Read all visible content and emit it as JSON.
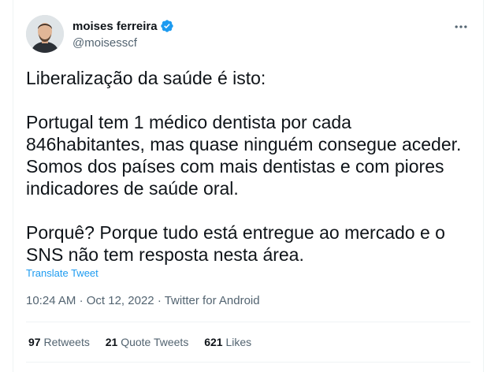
{
  "author": {
    "display_name": "moises ferreira",
    "handle": "@moisesscf",
    "verified": true
  },
  "icons": {
    "verified": "verified-badge-icon",
    "more": "more-options-icon"
  },
  "tweet": {
    "paragraphs": [
      "Liberalização da saúde é isto:",
      "Portugal tem 1 médico dentista por cada 846habitantes, mas quase ninguém consegue aceder. Somos dos países com mais dentistas e com piores indicadores de saúde oral.",
      "Porquê? Porque tudo está entregue ao mercado e o SNS não tem resposta nesta área."
    ],
    "translate_label": "Translate Tweet",
    "time": "10:24 AM",
    "date": "Oct 12, 2022",
    "source": "Twitter for Android",
    "separator": "·"
  },
  "stats": {
    "retweets_count": "97",
    "retweets_label": "Retweets",
    "quotes_count": "21",
    "quotes_label": "Quote Tweets",
    "likes_count": "621",
    "likes_label": "Likes"
  },
  "colors": {
    "accent": "#1d9bf0",
    "text": "#0f1419",
    "secondary": "#536471",
    "divider": "#eff3f4"
  }
}
